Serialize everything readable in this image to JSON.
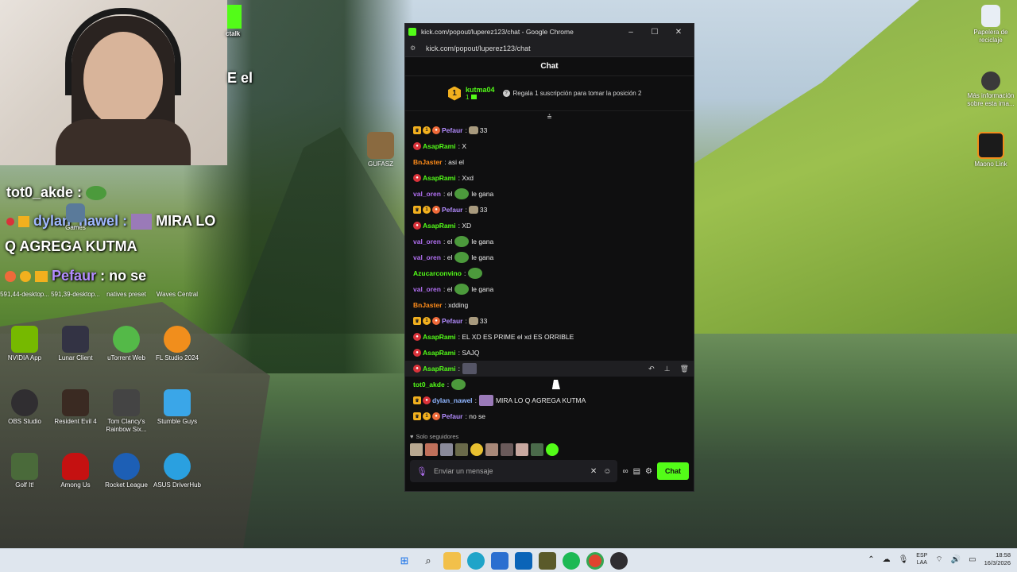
{
  "browser": {
    "window_title": "kick.com/popout/luperez123/chat - Google Chrome",
    "url": "kick.com/popout/luperez123/chat",
    "minimize": "–",
    "maximize": "☐",
    "close": "✕"
  },
  "chat": {
    "header": "Chat",
    "leader": {
      "rank": "1",
      "name": "kutma04",
      "count": "1"
    },
    "gift_prompt": "Regala 1 suscripción para tomar la posición 2",
    "followers_only": "Solo seguidores",
    "input_placeholder": "Enviar un mensaje",
    "send_label": "Chat",
    "messages": [
      {
        "user": "Pefaur",
        "color": "#b38cff",
        "text": "33"
      },
      {
        "user": "AsapRami",
        "color": "#53fc18",
        "text": "X"
      },
      {
        "user": "BnJaster",
        "color": "#ff8c1a",
        "text": "asi el"
      },
      {
        "user": "AsapRami",
        "color": "#53fc18",
        "text": "Xxd"
      },
      {
        "user": "val_oren",
        "color": "#b06ff0",
        "text": "el",
        "after": "le gana"
      },
      {
        "user": "Pefaur",
        "color": "#b38cff",
        "text": "33"
      },
      {
        "user": "AsapRami",
        "color": "#53fc18",
        "text": "XD"
      },
      {
        "user": "val_oren",
        "color": "#b06ff0",
        "text": "el",
        "after": "le gana"
      },
      {
        "user": "val_oren",
        "color": "#b06ff0",
        "text": "el",
        "after": "le gana"
      },
      {
        "user": "Azucarconvino",
        "color": "#53fc18",
        "text": ""
      },
      {
        "user": "val_oren",
        "color": "#b06ff0",
        "text": "el",
        "after": "le gana"
      },
      {
        "user": "BnJaster",
        "color": "#ff8c1a",
        "text": "xdding"
      },
      {
        "user": "Pefaur",
        "color": "#b38cff",
        "text": "33"
      },
      {
        "user": "AsapRami",
        "color": "#53fc18",
        "text": "EL XD ES PRIME el xd ES ORRIBLE"
      },
      {
        "user": "AsapRami",
        "color": "#53fc18",
        "text": "SAJQ"
      },
      {
        "user": "AsapRami",
        "color": "#53fc18",
        "text": ""
      },
      {
        "user": "tot0_akde",
        "color": "#53fc18",
        "text": ""
      },
      {
        "user": "dylan_nawel",
        "color": "#8fb5ff",
        "text": "MIRA LO Q AGREGA KUTMA"
      },
      {
        "user": "Pefaur",
        "color": "#b38cff",
        "text": "no se"
      }
    ]
  },
  "overlay": {
    "tot0": "tot0_akde :",
    "dylan": "dylan_nawel :",
    "dylan_msg1": "MIRA LO",
    "dylan_msg2": "Q AGREGA KUTMA",
    "pefaur": "Pefaur",
    "pefaur_msg": ": no se",
    "partial": "E el",
    "partial2": "ctalk"
  },
  "desktop_icons": [
    {
      "label": "GUFASZ",
      "color": "#8a6a40"
    },
    {
      "label": "Papelera de reciclaje",
      "color": "#e8eef5"
    },
    {
      "label": "Más información sobre esta ima...",
      "color": "#3a3a3a"
    },
    {
      "label": "Maono Link",
      "color": "#1b1b1b"
    },
    {
      "label": "Games",
      "color": "#5a7a9a"
    },
    {
      "label": "591,44-desktop...",
      "color": "#444"
    },
    {
      "label": "591,39-desktop...",
      "color": "#555"
    },
    {
      "label": "natives preset",
      "color": "#666"
    },
    {
      "label": "Waves Central",
      "color": "#222"
    },
    {
      "label": "NVIDIA App",
      "color": "#76b900"
    },
    {
      "label": "Lunar Client",
      "color": "#334"
    },
    {
      "label": "uTorrent Web",
      "color": "#54b948"
    },
    {
      "label": "FL Studio 2024",
      "color": "#f18e1c"
    },
    {
      "label": "OBS Studio",
      "color": "#302e31"
    },
    {
      "label": "Resident Evil 4",
      "color": "#3a2a22"
    },
    {
      "label": "Tom Clancy's Rainbow Six...",
      "color": "#444"
    },
    {
      "label": "Stumble Guys",
      "color": "#3aa6e8"
    },
    {
      "label": "Golf It!",
      "color": "#4a6a3a"
    },
    {
      "label": "Among Us",
      "color": "#c51111"
    },
    {
      "label": "Rocket League",
      "color": "#1d5fb5"
    },
    {
      "label": "ASUS DriverHub",
      "color": "#2aa0e0"
    }
  ],
  "taskbar": {
    "lang_line1": "ESP",
    "lang_line2": "LAA",
    "time": "18:58",
    "date": "16/3/2026"
  }
}
